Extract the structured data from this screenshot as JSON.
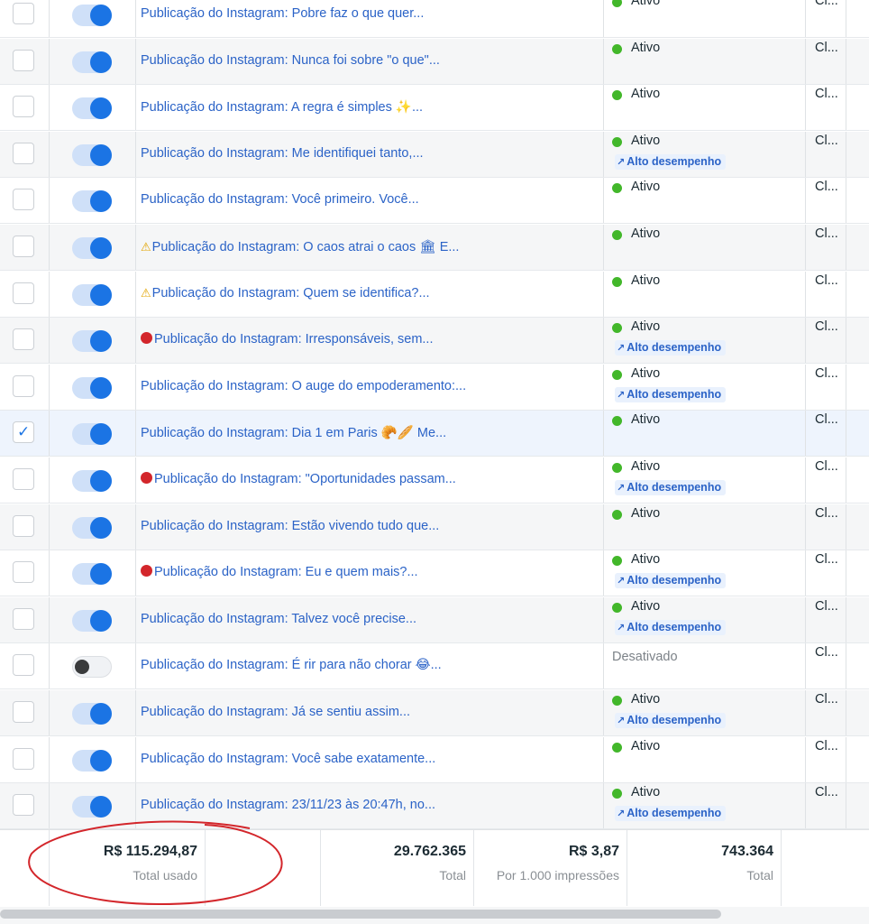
{
  "rows": [
    {
      "name": "Publicação do Instagram: Pobre faz o que quer...",
      "prefix": "",
      "status": "Ativo",
      "perf": "",
      "col5": "Cl...",
      "toggle": "on",
      "checked": false
    },
    {
      "name": "Publicação do Instagram: Nunca foi sobre \"o que\"...",
      "prefix": "",
      "status": "Ativo",
      "perf": "",
      "col5": "Cl...",
      "toggle": "on",
      "checked": false
    },
    {
      "name": "Publicação do Instagram: A regra é simples ✨...",
      "prefix": "",
      "status": "Ativo",
      "perf": "",
      "col5": "Cl...",
      "toggle": "on",
      "checked": false
    },
    {
      "name": "Publicação do Instagram: Me identifiquei tanto,...",
      "prefix": "",
      "status": "Ativo",
      "perf": "Alto desempenho",
      "col5": "Cl...",
      "toggle": "on",
      "checked": false
    },
    {
      "name": "Publicação do Instagram: Você primeiro. Você...",
      "prefix": "",
      "status": "Ativo",
      "perf": "",
      "col5": "Cl...",
      "toggle": "on",
      "checked": false
    },
    {
      "name": "Publicação do Instagram: O caos atrai o caos 🏛 E...",
      "prefix": "warning",
      "status": "Ativo",
      "perf": "",
      "col5": "Cl...",
      "toggle": "on",
      "checked": false
    },
    {
      "name": "Publicação do Instagram: Quem se identifica?...",
      "prefix": "warning",
      "status": "Ativo",
      "perf": "",
      "col5": "Cl...",
      "toggle": "on",
      "checked": false
    },
    {
      "name": "Publicação do Instagram: Irresponsáveis, sem...",
      "prefix": "red-dot",
      "status": "Ativo",
      "perf": "Alto desempenho",
      "col5": "Cl...",
      "toggle": "on",
      "checked": false
    },
    {
      "name": "Publicação do Instagram: O auge do empoderamento:...",
      "prefix": "",
      "status": "Ativo",
      "perf": "Alto desempenho",
      "col5": "Cl...",
      "toggle": "on",
      "checked": false
    },
    {
      "name": "Publicação do Instagram: Dia 1 em Paris 🥐🥖 Me...",
      "prefix": "",
      "status": "Ativo",
      "perf": "",
      "col5": "Cl...",
      "toggle": "on",
      "checked": true
    },
    {
      "name": "Publicação do Instagram: \"Oportunidades passam...",
      "prefix": "red-dot",
      "status": "Ativo",
      "perf": "Alto desempenho",
      "col5": "Cl...",
      "toggle": "on",
      "checked": false
    },
    {
      "name": "Publicação do Instagram: Estão vivendo tudo que...",
      "prefix": "",
      "status": "Ativo",
      "perf": "",
      "col5": "Cl...",
      "toggle": "on",
      "checked": false
    },
    {
      "name": "Publicação do Instagram: Eu e quem mais?...",
      "prefix": "red-dot",
      "status": "Ativo",
      "perf": "Alto desempenho",
      "col5": "Cl...",
      "toggle": "on",
      "checked": false
    },
    {
      "name": "Publicação do Instagram: Talvez você precise...",
      "prefix": "",
      "status": "Ativo",
      "perf": "Alto desempenho",
      "col5": "Cl...",
      "toggle": "on",
      "checked": false
    },
    {
      "name": "Publicação do Instagram: É rir para não chorar 😂...",
      "prefix": "",
      "status": "Desativado",
      "perf": "",
      "col5": "Cl...",
      "toggle": "off",
      "checked": false
    },
    {
      "name": "Publicação do Instagram: Já se sentiu assim...",
      "prefix": "",
      "status": "Ativo",
      "perf": "Alto desempenho",
      "col5": "Cl...",
      "toggle": "on",
      "checked": false
    },
    {
      "name": "Publicação do Instagram: Você sabe exatamente...",
      "prefix": "",
      "status": "Ativo",
      "perf": "",
      "col5": "Cl...",
      "toggle": "on",
      "checked": false
    },
    {
      "name": "Publicação do Instagram: 23/11/23 às 20:47h, no...",
      "prefix": "",
      "status": "Ativo",
      "perf": "Alto desempenho",
      "col5": "Cl...",
      "toggle": "on",
      "checked": false
    }
  ],
  "footer": [
    {
      "value": "R$ 115.294,87",
      "label": "Total usado"
    },
    {
      "value": "29.762.365",
      "label": "Total"
    },
    {
      "value": "R$ 3,87",
      "label": "Por 1.000 impressões"
    },
    {
      "value": "743.364",
      "label": "Total"
    }
  ],
  "colors": {
    "link": "#2b63c7",
    "active": "#42b72a",
    "toggle_on": "#1b74e4",
    "highlight_ellipse": "#d3262b"
  }
}
